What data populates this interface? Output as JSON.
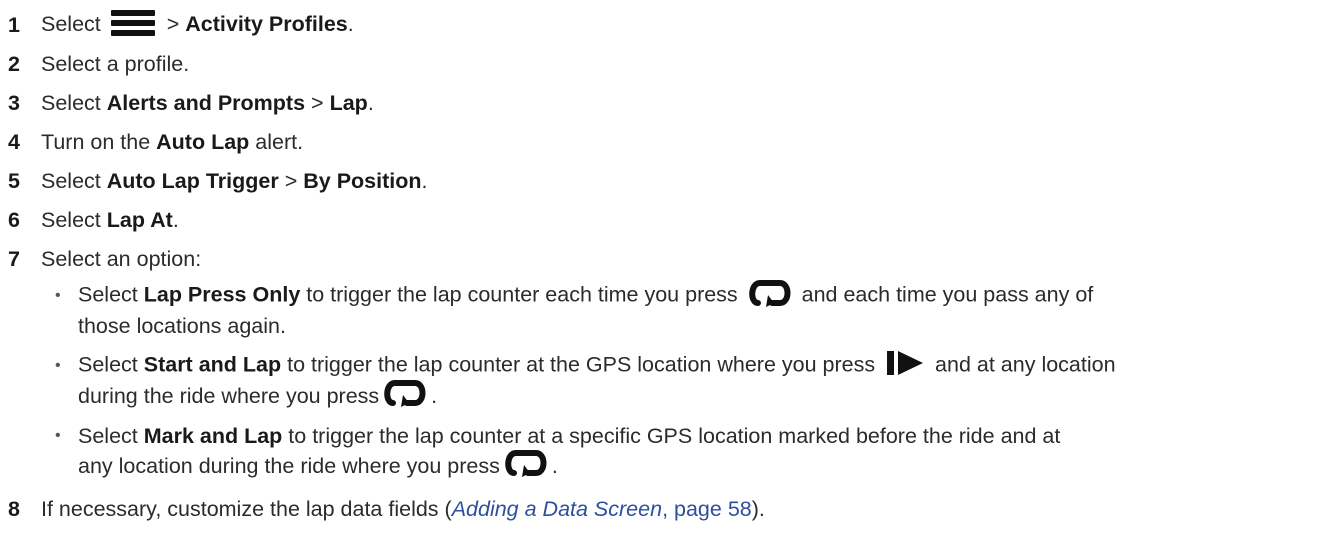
{
  "steps": [
    {
      "num": "1",
      "pre": "Select ",
      "post": " > ",
      "bold": "Activity Profiles",
      "end": "."
    },
    {
      "num": "2",
      "text": "Select a profile."
    },
    {
      "num": "3",
      "pre": "Select ",
      "bold1": "Alerts and Prompts",
      "mid": " > ",
      "bold2": "Lap",
      "end": "."
    },
    {
      "num": "4",
      "pre": "Turn on the ",
      "bold": "Auto Lap",
      "end": " alert."
    },
    {
      "num": "5",
      "pre": "Select ",
      "bold1": "Auto Lap Trigger",
      "mid": " > ",
      "bold2": "By Position",
      "end": "."
    },
    {
      "num": "6",
      "pre": "Select ",
      "bold": "Lap At",
      "end": "."
    },
    {
      "num": "7",
      "text": "Select an option:"
    },
    {
      "num": "8",
      "pre": "If necessary, customize the lap data fields (",
      "link_text": "Adding a Data Screen",
      "link_sep": ", ",
      "link_page": "page 58",
      "end": ")."
    }
  ],
  "options": [
    {
      "bullet": "•",
      "line1_pre": "Select ",
      "bold": "Lap Press Only",
      "line1_mid": " to trigger the lap counter each time you press ",
      "line1_post": " and each time you pass any of",
      "line2": "those locations again."
    },
    {
      "bullet": "•",
      "line1_pre": "Select ",
      "bold": "Start and Lap",
      "line1_mid": " to trigger the lap counter at the GPS location where you press ",
      "line1_post": " and at any location",
      "line2_pre": "during the ride where you press ",
      "line2_end": "."
    },
    {
      "bullet": "•",
      "line1_pre": "Select ",
      "bold": "Mark and Lap",
      "line1_mid": " to trigger the lap counter at a specific GPS location marked before the ride and at",
      "line2_pre": "any location during the ride where you press ",
      "line2_end": "."
    }
  ],
  "icons": {
    "menu": "menu-icon",
    "lap": "lap-loop-icon",
    "start": "start-play-icon"
  }
}
